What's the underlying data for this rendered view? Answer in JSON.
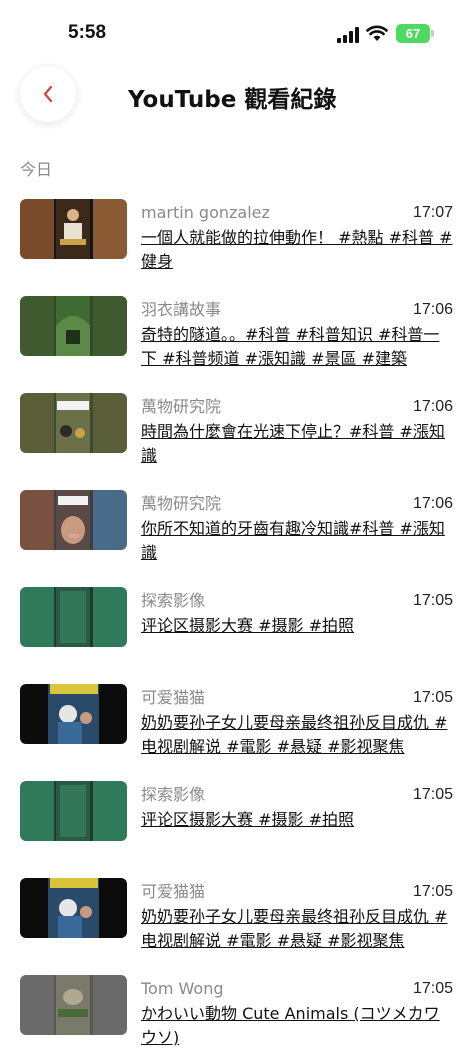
{
  "status": {
    "time": "5:58",
    "battery": "67"
  },
  "header": {
    "title": "YouTube 觀看紀錄"
  },
  "section": {
    "today_label": "今日"
  },
  "items": [
    {
      "channel": "martin gonzalez",
      "time": "17:07",
      "title": "一個人就能做的拉伸動作！ #熱點 #科普 #健身"
    },
    {
      "channel": "羽衣講故事",
      "time": "17:06",
      "title": "奇特的隧道。。#科普 #科普知识 #科普一下 #科普频道 #漲知識 #景區 #建築"
    },
    {
      "channel": "萬物研究院",
      "time": "17:06",
      "title": "時間為什麼會在光速下停止？#科普 #漲知識"
    },
    {
      "channel": "萬物研究院",
      "time": "17:06",
      "title": "你所不知道的牙齒有趣冷知識#科普 #漲知識"
    },
    {
      "channel": "探索影像",
      "time": "17:05",
      "title": "评论区摄影大赛 #摄影 #拍照"
    },
    {
      "channel": "可爱猫猫",
      "time": "17:05",
      "title": "奶奶要孙子女儿要母亲最终祖孙反目成仇 #电视剧解说 #電影 #悬疑 #影视聚焦"
    },
    {
      "channel": "探索影像",
      "time": "17:05",
      "title": "评论区摄影大赛 #摄影 #拍照"
    },
    {
      "channel": "可爱猫猫",
      "time": "17:05",
      "title": "奶奶要孙子女儿要母亲最终祖孙反目成仇 #电视剧解说 #電影 #悬疑 #影视聚焦"
    },
    {
      "channel": "Tom Wong",
      "time": "17:05",
      "title": "かわいい動物 Cute Animals (コツメカワウソ)"
    }
  ]
}
